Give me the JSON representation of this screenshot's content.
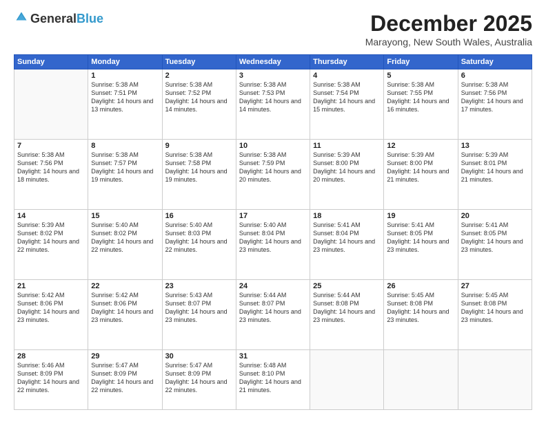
{
  "logo": {
    "general": "General",
    "blue": "Blue"
  },
  "header": {
    "month": "December 2025",
    "location": "Marayong, New South Wales, Australia"
  },
  "weekdays": [
    "Sunday",
    "Monday",
    "Tuesday",
    "Wednesday",
    "Thursday",
    "Friday",
    "Saturday"
  ],
  "weeks": [
    [
      {
        "day": "",
        "sunrise": "",
        "sunset": "",
        "daylight": ""
      },
      {
        "day": "1",
        "sunrise": "Sunrise: 5:38 AM",
        "sunset": "Sunset: 7:51 PM",
        "daylight": "Daylight: 14 hours and 13 minutes."
      },
      {
        "day": "2",
        "sunrise": "Sunrise: 5:38 AM",
        "sunset": "Sunset: 7:52 PM",
        "daylight": "Daylight: 14 hours and 14 minutes."
      },
      {
        "day": "3",
        "sunrise": "Sunrise: 5:38 AM",
        "sunset": "Sunset: 7:53 PM",
        "daylight": "Daylight: 14 hours and 14 minutes."
      },
      {
        "day": "4",
        "sunrise": "Sunrise: 5:38 AM",
        "sunset": "Sunset: 7:54 PM",
        "daylight": "Daylight: 14 hours and 15 minutes."
      },
      {
        "day": "5",
        "sunrise": "Sunrise: 5:38 AM",
        "sunset": "Sunset: 7:55 PM",
        "daylight": "Daylight: 14 hours and 16 minutes."
      },
      {
        "day": "6",
        "sunrise": "Sunrise: 5:38 AM",
        "sunset": "Sunset: 7:56 PM",
        "daylight": "Daylight: 14 hours and 17 minutes."
      }
    ],
    [
      {
        "day": "7",
        "sunrise": "Sunrise: 5:38 AM",
        "sunset": "Sunset: 7:56 PM",
        "daylight": "Daylight: 14 hours and 18 minutes."
      },
      {
        "day": "8",
        "sunrise": "Sunrise: 5:38 AM",
        "sunset": "Sunset: 7:57 PM",
        "daylight": "Daylight: 14 hours and 19 minutes."
      },
      {
        "day": "9",
        "sunrise": "Sunrise: 5:38 AM",
        "sunset": "Sunset: 7:58 PM",
        "daylight": "Daylight: 14 hours and 19 minutes."
      },
      {
        "day": "10",
        "sunrise": "Sunrise: 5:38 AM",
        "sunset": "Sunset: 7:59 PM",
        "daylight": "Daylight: 14 hours and 20 minutes."
      },
      {
        "day": "11",
        "sunrise": "Sunrise: 5:39 AM",
        "sunset": "Sunset: 8:00 PM",
        "daylight": "Daylight: 14 hours and 20 minutes."
      },
      {
        "day": "12",
        "sunrise": "Sunrise: 5:39 AM",
        "sunset": "Sunset: 8:00 PM",
        "daylight": "Daylight: 14 hours and 21 minutes."
      },
      {
        "day": "13",
        "sunrise": "Sunrise: 5:39 AM",
        "sunset": "Sunset: 8:01 PM",
        "daylight": "Daylight: 14 hours and 21 minutes."
      }
    ],
    [
      {
        "day": "14",
        "sunrise": "Sunrise: 5:39 AM",
        "sunset": "Sunset: 8:02 PM",
        "daylight": "Daylight: 14 hours and 22 minutes."
      },
      {
        "day": "15",
        "sunrise": "Sunrise: 5:40 AM",
        "sunset": "Sunset: 8:02 PM",
        "daylight": "Daylight: 14 hours and 22 minutes."
      },
      {
        "day": "16",
        "sunrise": "Sunrise: 5:40 AM",
        "sunset": "Sunset: 8:03 PM",
        "daylight": "Daylight: 14 hours and 22 minutes."
      },
      {
        "day": "17",
        "sunrise": "Sunrise: 5:40 AM",
        "sunset": "Sunset: 8:04 PM",
        "daylight": "Daylight: 14 hours and 23 minutes."
      },
      {
        "day": "18",
        "sunrise": "Sunrise: 5:41 AM",
        "sunset": "Sunset: 8:04 PM",
        "daylight": "Daylight: 14 hours and 23 minutes."
      },
      {
        "day": "19",
        "sunrise": "Sunrise: 5:41 AM",
        "sunset": "Sunset: 8:05 PM",
        "daylight": "Daylight: 14 hours and 23 minutes."
      },
      {
        "day": "20",
        "sunrise": "Sunrise: 5:41 AM",
        "sunset": "Sunset: 8:05 PM",
        "daylight": "Daylight: 14 hours and 23 minutes."
      }
    ],
    [
      {
        "day": "21",
        "sunrise": "Sunrise: 5:42 AM",
        "sunset": "Sunset: 8:06 PM",
        "daylight": "Daylight: 14 hours and 23 minutes."
      },
      {
        "day": "22",
        "sunrise": "Sunrise: 5:42 AM",
        "sunset": "Sunset: 8:06 PM",
        "daylight": "Daylight: 14 hours and 23 minutes."
      },
      {
        "day": "23",
        "sunrise": "Sunrise: 5:43 AM",
        "sunset": "Sunset: 8:07 PM",
        "daylight": "Daylight: 14 hours and 23 minutes."
      },
      {
        "day": "24",
        "sunrise": "Sunrise: 5:44 AM",
        "sunset": "Sunset: 8:07 PM",
        "daylight": "Daylight: 14 hours and 23 minutes."
      },
      {
        "day": "25",
        "sunrise": "Sunrise: 5:44 AM",
        "sunset": "Sunset: 8:08 PM",
        "daylight": "Daylight: 14 hours and 23 minutes."
      },
      {
        "day": "26",
        "sunrise": "Sunrise: 5:45 AM",
        "sunset": "Sunset: 8:08 PM",
        "daylight": "Daylight: 14 hours and 23 minutes."
      },
      {
        "day": "27",
        "sunrise": "Sunrise: 5:45 AM",
        "sunset": "Sunset: 8:08 PM",
        "daylight": "Daylight: 14 hours and 23 minutes."
      }
    ],
    [
      {
        "day": "28",
        "sunrise": "Sunrise: 5:46 AM",
        "sunset": "Sunset: 8:09 PM",
        "daylight": "Daylight: 14 hours and 22 minutes."
      },
      {
        "day": "29",
        "sunrise": "Sunrise: 5:47 AM",
        "sunset": "Sunset: 8:09 PM",
        "daylight": "Daylight: 14 hours and 22 minutes."
      },
      {
        "day": "30",
        "sunrise": "Sunrise: 5:47 AM",
        "sunset": "Sunset: 8:09 PM",
        "daylight": "Daylight: 14 hours and 22 minutes."
      },
      {
        "day": "31",
        "sunrise": "Sunrise: 5:48 AM",
        "sunset": "Sunset: 8:10 PM",
        "daylight": "Daylight: 14 hours and 21 minutes."
      },
      {
        "day": "",
        "sunrise": "",
        "sunset": "",
        "daylight": ""
      },
      {
        "day": "",
        "sunrise": "",
        "sunset": "",
        "daylight": ""
      },
      {
        "day": "",
        "sunrise": "",
        "sunset": "",
        "daylight": ""
      }
    ]
  ]
}
